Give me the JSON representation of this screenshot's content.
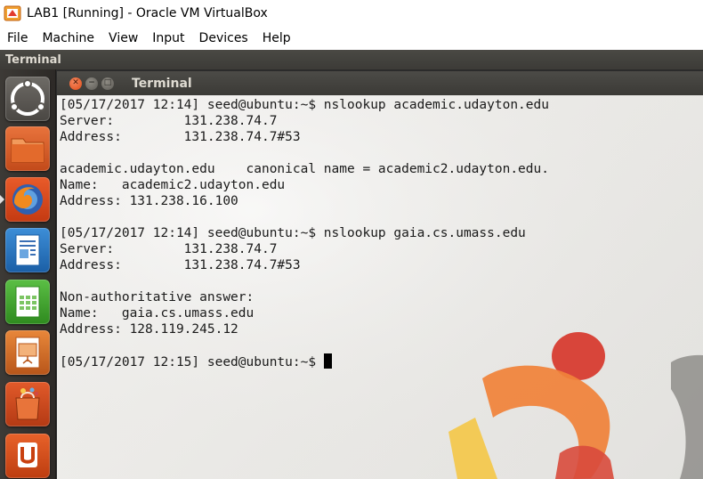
{
  "vbox": {
    "title": "LAB1 [Running] - Oracle VM VirtualBox",
    "menu": [
      "File",
      "Machine",
      "View",
      "Input",
      "Devices",
      "Help"
    ]
  },
  "topbar": {
    "title": "Terminal"
  },
  "terminal": {
    "title": "Terminal",
    "lines": [
      "[05/17/2017 12:14] seed@ubuntu:~$ nslookup academic.udayton.edu",
      "Server:         131.238.74.7",
      "Address:        131.238.74.7#53",
      "",
      "academic.udayton.edu    canonical name = academic2.udayton.edu.",
      "Name:   academic2.udayton.edu",
      "Address: 131.238.16.100",
      "",
      "[05/17/2017 12:14] seed@ubuntu:~$ nslookup gaia.cs.umass.edu",
      "Server:         131.238.74.7",
      "Address:        131.238.74.7#53",
      "",
      "Non-authoritative answer:",
      "Name:   gaia.cs.umass.edu",
      "Address: 128.119.245.12",
      "",
      "[05/17/2017 12:15] seed@ubuntu:~$ "
    ]
  },
  "launcher": [
    {
      "name": "dash-home-icon"
    },
    {
      "name": "files-icon"
    },
    {
      "name": "firefox-icon"
    },
    {
      "name": "writer-icon"
    },
    {
      "name": "calc-icon"
    },
    {
      "name": "impress-icon"
    },
    {
      "name": "software-center-icon"
    },
    {
      "name": "ubuntu-one-icon"
    }
  ],
  "colors": {
    "accent": "#dd4814",
    "topbar": "#3c3b37",
    "launcher": "#3d3a36"
  }
}
